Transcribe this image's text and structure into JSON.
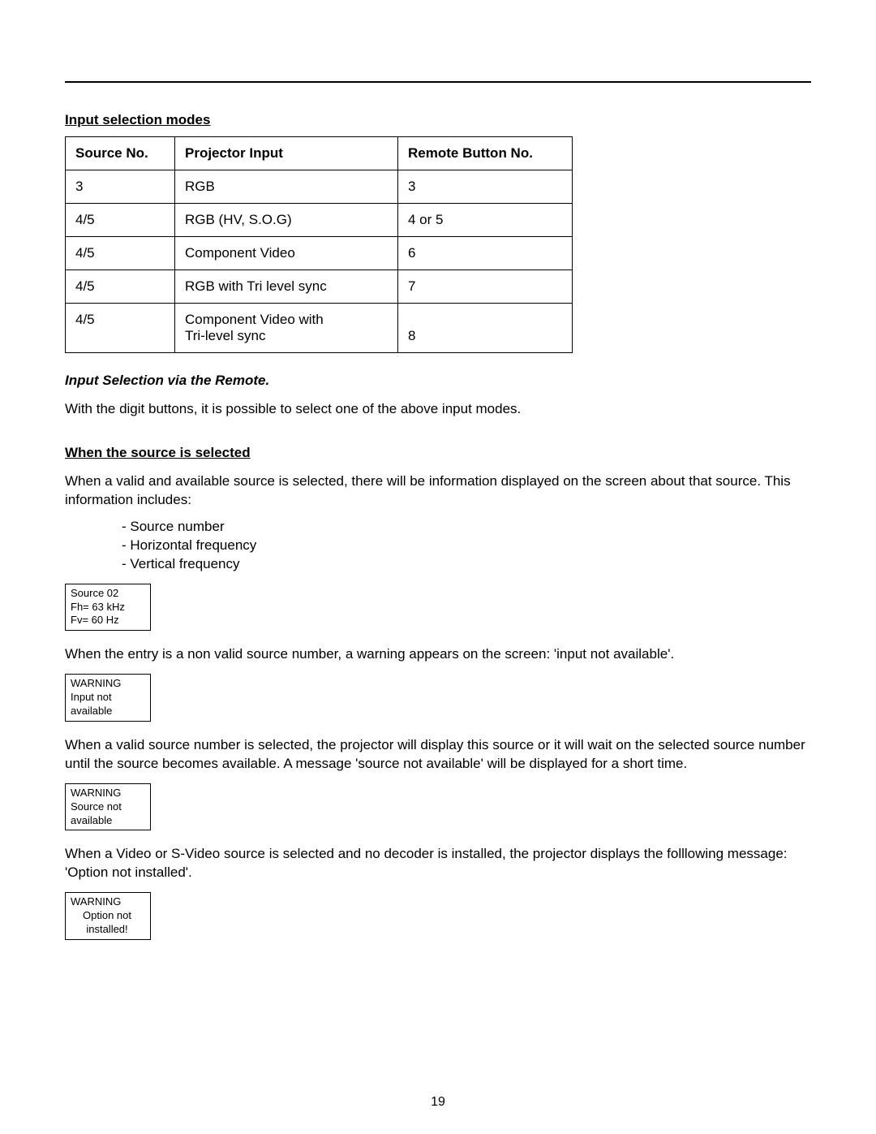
{
  "headings": {
    "input_modes": "Input selection modes",
    "via_remote": "Input Selection via the Remote.",
    "when_selected": "When the source is selected"
  },
  "table": {
    "headers": {
      "a": "Source No.",
      "b": "Projector Input",
      "c": "Remote Button No."
    },
    "rows": [
      {
        "a": "3",
        "b": "RGB",
        "c": "3"
      },
      {
        "a": "4/5",
        "b": "RGB (HV, S.O.G)",
        "c": "4 or 5"
      },
      {
        "a": "4/5",
        "b": "Component Video",
        "c": "6"
      },
      {
        "a": "4/5",
        "b": "RGB with Tri level sync",
        "c": "7"
      },
      {
        "a": "4/5",
        "b": "Component Video with\nTri-level sync",
        "c": "8"
      }
    ]
  },
  "paras": {
    "p1": "With the digit buttons, it is possible to select one of the above input modes.",
    "p2": "When a valid and available source is selected, there will be information displayed on the screen about that source. This information includes:",
    "list": {
      "i1": "- Source number",
      "i2": "- Horizontal frequency",
      "i3": "- Vertical frequency"
    },
    "p3": "When the entry is a non valid source number, a warning appears on the screen: 'input not available'.",
    "p4": "When a valid source number is selected, the projector will display this source or it will wait on the selected source number until the source becomes available. A message 'source not available' will be displayed for a short time.",
    "p5": "When a Video or S-Video source is selected and no decoder is installed, the projector displays the folllowing message: 'Option not installed'."
  },
  "boxes": {
    "b1": {
      "l1": "Source 02",
      "l2": "Fh= 63 kHz",
      "l3": "Fv= 60 Hz"
    },
    "b2": {
      "l1": "WARNING",
      "l2": "Input not",
      "l3": "available"
    },
    "b3": {
      "l1": "WARNING",
      "l2": "Source not",
      "l3": "available"
    },
    "b4": {
      "l1": "WARNING",
      "l2": "Option not",
      "l3": "installed!"
    }
  },
  "page_number": "19"
}
